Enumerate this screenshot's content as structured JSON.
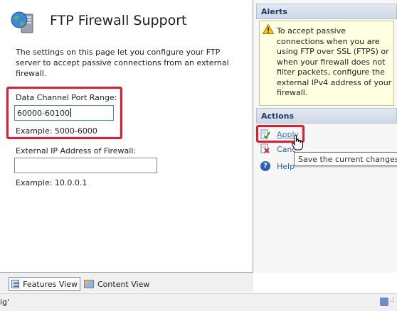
{
  "page": {
    "title": "FTP Firewall Support",
    "description": "The settings on this page let you configure your FTP server to accept passive connections from an external firewall.",
    "port_range_label": "Data Channel Port Range:",
    "port_range_value": "60000-60100",
    "port_range_example": "Example: 5000-6000",
    "external_ip_label": "External IP Address of Firewall:",
    "external_ip_value": "",
    "external_ip_example": "Example: 10.0.0.1"
  },
  "view_tabs": {
    "features": "Features View",
    "content": "Content View",
    "selected": "Features View"
  },
  "status_bar": {
    "text": "ig'"
  },
  "alerts": {
    "header": "Alerts",
    "message": "To accept passive connections when you are using FTP over SSL (FTPS) or when your firewall does not filter packets, configure the external IPv4 address of your firewall."
  },
  "actions": {
    "header": "Actions",
    "apply": "Apply",
    "cancel": "Cancel",
    "help": "Help"
  },
  "tooltip": {
    "text": "Save the current changes."
  },
  "icons": {
    "page": "ftp-globe-server-icon",
    "warning": "warning-icon",
    "apply": "apply-icon",
    "cancel": "cancel-icon",
    "help": "help-icon",
    "cursor": "hand-cursor-icon"
  },
  "colors": {
    "highlight": "#e8192c",
    "link": "#2a62b6",
    "alert_background": "#ffffe1",
    "header_text": "#1e3b6a"
  }
}
